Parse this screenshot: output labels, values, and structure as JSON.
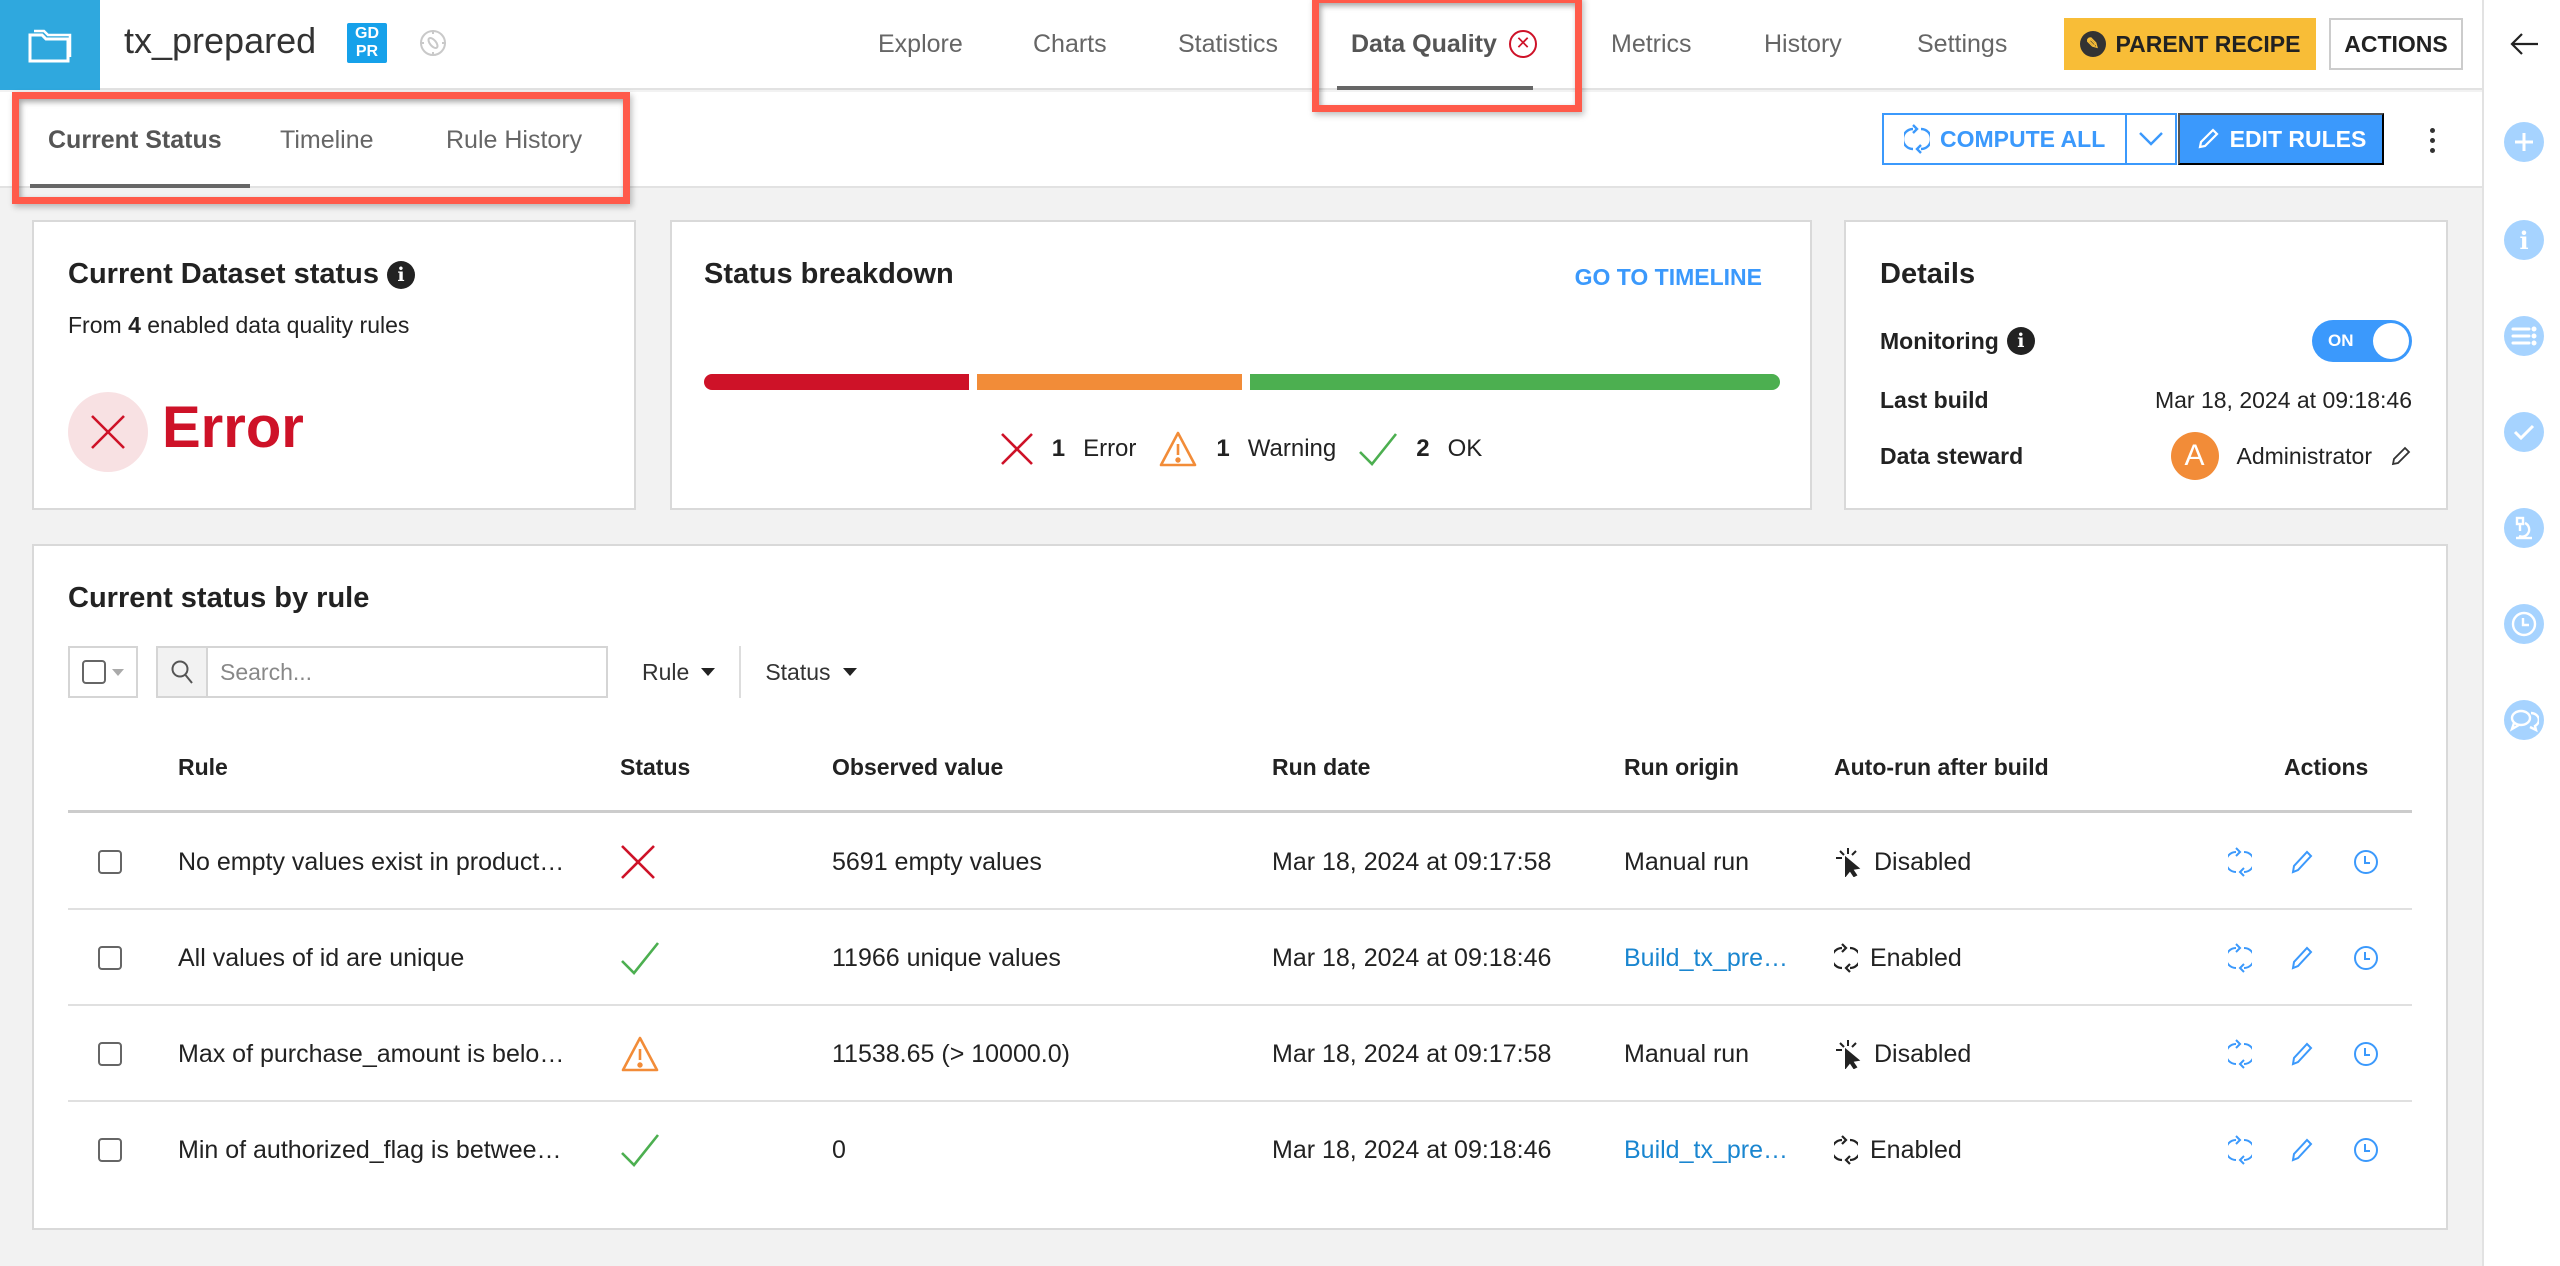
{
  "header": {
    "dataset_name": "tx_prepared",
    "gdpr_badge": [
      "GD",
      "PR"
    ],
    "icons": {
      "folder": "folder-icon",
      "compass": "compass-icon"
    },
    "nav": [
      {
        "label": "Explore",
        "active": false
      },
      {
        "label": "Charts",
        "active": false
      },
      {
        "label": "Statistics",
        "active": false
      },
      {
        "label": "Data Quality",
        "active": true,
        "status_icon": "error-circle-x-icon"
      },
      {
        "label": "Metrics",
        "active": false
      },
      {
        "label": "History",
        "active": false
      },
      {
        "label": "Settings",
        "active": false
      }
    ],
    "parent_recipe_label": "PARENT RECIPE",
    "actions_label": "ACTIONS"
  },
  "subtabs": [
    {
      "label": "Current Status",
      "active": true
    },
    {
      "label": "Timeline",
      "active": false
    },
    {
      "label": "Rule History",
      "active": false
    }
  ],
  "toolbar": {
    "compute_all_label": "COMPUTE ALL",
    "edit_rules_label": "EDIT RULES"
  },
  "dataset_status": {
    "title": "Current Dataset status",
    "subtitle_prefix": "From",
    "rule_count": "4",
    "subtitle_suffix": "enabled data quality rules",
    "status": "Error"
  },
  "breakdown": {
    "title": "Status breakdown",
    "goto_label": "GO TO TIMELINE",
    "segments": [
      {
        "status": "Error",
        "count": 1,
        "color": "#ce1228"
      },
      {
        "status": "Warning",
        "count": 1,
        "color": "#f28c38"
      },
      {
        "status": "OK",
        "count": 2,
        "color": "#4caf50"
      }
    ],
    "legend": [
      {
        "count": "1",
        "label": "Error"
      },
      {
        "count": "1",
        "label": "Warning"
      },
      {
        "count": "2",
        "label": "OK"
      }
    ]
  },
  "details": {
    "title": "Details",
    "monitoring_label": "Monitoring",
    "monitoring_value": "ON",
    "monitoring_on": true,
    "last_build_label": "Last build",
    "last_build_value": "Mar 18, 2024 at 09:18:46",
    "steward_label": "Data steward",
    "steward_initial": "A",
    "steward_name": "Administrator"
  },
  "rules_table": {
    "title": "Current status by rule",
    "search_placeholder": "Search...",
    "filters": [
      "Rule",
      "Status"
    ],
    "columns": [
      "Rule",
      "Status",
      "Observed value",
      "Run date",
      "Run origin",
      "Auto-run after build",
      "Actions"
    ],
    "rows": [
      {
        "rule": "No empty values exist in product…",
        "status": "error",
        "observed": "5691 empty values",
        "run_date": "Mar 18, 2024 at 09:17:58",
        "origin": "Manual run",
        "origin_link": false,
        "autorun": "Disabled"
      },
      {
        "rule": "All values of id are unique",
        "status": "ok",
        "observed": "11966 unique values",
        "run_date": "Mar 18, 2024 at 09:18:46",
        "origin": "Build_tx_pre…",
        "origin_link": true,
        "autorun": "Enabled"
      },
      {
        "rule": "Max of purchase_amount is belo…",
        "status": "warning",
        "observed": "11538.65 (> 10000.0)",
        "run_date": "Mar 18, 2024 at 09:17:58",
        "origin": "Manual run",
        "origin_link": false,
        "autorun": "Disabled"
      },
      {
        "rule": "Min of authorized_flag is betwee…",
        "status": "ok",
        "observed": "0",
        "run_date": "Mar 18, 2024 at 09:18:46",
        "origin": "Build_tx_pre…",
        "origin_link": true,
        "autorun": "Enabled"
      }
    ]
  },
  "colors": {
    "accent": "#3b99fc",
    "error": "#ce1228",
    "warning": "#f28c38",
    "ok": "#4caf50",
    "folder_block": "#2fa8de",
    "parent_recipe": "#f8bd37",
    "highlight": "#ff5a4a"
  },
  "right_sidebar": [
    "back-arrow-icon",
    "plus-icon",
    "info-icon",
    "list-icon",
    "check-icon",
    "lab-icon",
    "clock-icon",
    "chat-icon"
  ]
}
